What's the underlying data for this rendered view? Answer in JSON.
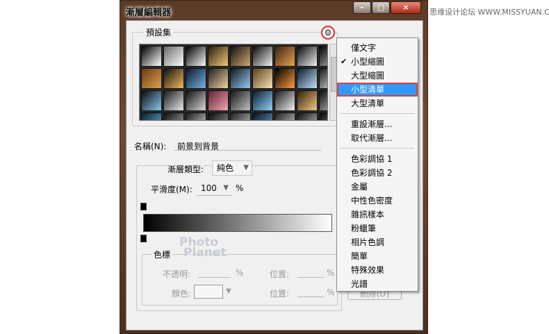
{
  "watermark": "思缘设计论坛 WWW.MISSYUAN.COM",
  "window": {
    "title": "漸層編輯器",
    "controls": {
      "minimize": "–",
      "maximize": "□",
      "close": "×"
    }
  },
  "presets": {
    "title": "預設集",
    "gear_glyph": "⚙",
    "swatches": [
      [
        "#000000",
        "#ffffff"
      ],
      [
        "#6a6a6a",
        "#ffffff"
      ],
      [
        "#000000",
        "#f8f8f8"
      ],
      [
        "#2a1a08",
        "#f0c878"
      ],
      [
        "#101010",
        "#d0a870"
      ],
      [
        "#0a0a0a",
        "#f2f2f2"
      ],
      [
        "#3a2410",
        "#e8a050"
      ],
      [
        "#0a0a0a",
        "#eeeeee"
      ],
      [
        "#000000",
        "#cccccc"
      ],
      [
        "#6a3a10",
        "#e0a050"
      ],
      [
        "#101010",
        "#f0b860"
      ],
      [
        "#0a1830",
        "#78b0e0"
      ],
      [
        "#202020",
        "#f0d0a0"
      ],
      [
        "#101822",
        "#98c8f0"
      ],
      [
        "#5a4020",
        "#f8e0b0"
      ],
      [
        "#000000",
        "#ff9a40"
      ],
      [
        "#0a1a2a",
        "#c0e0ff"
      ],
      [
        "#181818",
        "#f0f0f0"
      ],
      [
        "#0a0a0a",
        "#8ac8f0"
      ],
      [
        "#1a1a1a",
        "#e8e8e8"
      ],
      [
        "#101010",
        "#d8d8d8"
      ],
      [
        "#602030",
        "#f0a8b0"
      ],
      [
        "#181818",
        "#c0c0c0"
      ],
      [
        "#0a1a2a",
        "#90d0f8"
      ],
      [
        "#1a1a1a",
        "#f0f0f0"
      ],
      [
        "#302010",
        "#f0c880"
      ],
      [
        "#0a0a0a",
        "#d0d0d0"
      ],
      [
        "#082030",
        "#68b8e0"
      ],
      [
        "#101010",
        "#b0b0b0"
      ],
      [
        "#1a1a1a",
        "#e0e0e0"
      ],
      [
        "#0a0a0a",
        "#a0a0a0"
      ],
      [
        "#222222",
        "#cccccc"
      ],
      [
        "#0a1020",
        "#70a8d8"
      ],
      [
        "#202020",
        "#d8d8d8"
      ],
      [
        "#101010",
        "#c8c8c8"
      ],
      [
        "#000000",
        "#bbbbbb"
      ]
    ]
  },
  "name": {
    "label": "名稱(N):",
    "value": "前景到背景"
  },
  "gradient": {
    "type_label": "漸層類型:",
    "type_value": "純色",
    "smooth_label": "平滑度(M):",
    "smooth_value": "100",
    "smooth_unit": "%"
  },
  "stops": {
    "title": "色標",
    "opacity_label": "不透明:",
    "opacity_unit": "%",
    "position_label": "位置:",
    "position_unit": "%",
    "color_label": "顏色:",
    "position2_label": "位置:",
    "position2_unit": "%",
    "delete_button": "刪除(D)"
  },
  "logo": {
    "line1": "Photo",
    "line2": "Planet"
  },
  "menu": {
    "items": [
      {
        "label": "僅文字",
        "checked": false,
        "selected": false
      },
      {
        "label": "小型縮圖",
        "checked": true,
        "selected": false
      },
      {
        "label": "大型縮圖",
        "checked": false,
        "selected": false
      },
      {
        "label": "小型清單",
        "checked": false,
        "selected": true
      },
      {
        "label": "大型清單",
        "checked": false,
        "selected": false
      },
      {
        "label": "重設漸層...",
        "checked": false,
        "selected": false
      },
      {
        "label": "取代漸層...",
        "checked": false,
        "selected": false
      },
      {
        "label": "色彩調協 1",
        "checked": false,
        "selected": false
      },
      {
        "label": "色彩調協 2",
        "checked": false,
        "selected": false
      },
      {
        "label": "金屬",
        "checked": false,
        "selected": false
      },
      {
        "label": "中性色密度",
        "checked": false,
        "selected": false
      },
      {
        "label": "雜訊樣本",
        "checked": false,
        "selected": false
      },
      {
        "label": "粉蠟筆",
        "checked": false,
        "selected": false
      },
      {
        "label": "相片色調",
        "checked": false,
        "selected": false
      },
      {
        "label": "簡單",
        "checked": false,
        "selected": false
      },
      {
        "label": "特殊效果",
        "checked": false,
        "selected": false
      },
      {
        "label": "光譜",
        "checked": false,
        "selected": false
      }
    ],
    "checkmark": "✔"
  }
}
